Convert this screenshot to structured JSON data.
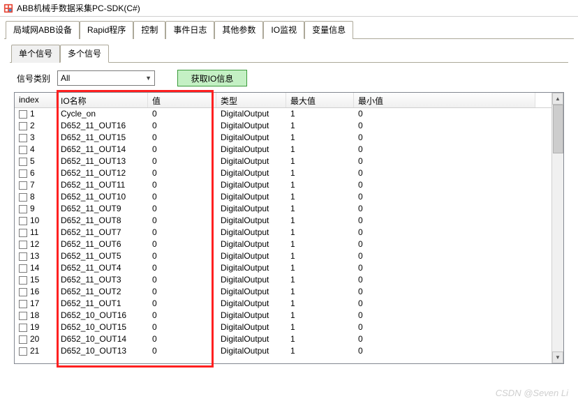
{
  "window": {
    "title": "ABB机械手数据采集PC-SDK(C#)"
  },
  "main_tabs": {
    "items": [
      {
        "label": "局域网ABB设备"
      },
      {
        "label": "Rapid程序"
      },
      {
        "label": "控制"
      },
      {
        "label": "事件日志"
      },
      {
        "label": "其他参数"
      },
      {
        "label": "IO监视"
      },
      {
        "label": "变量信息"
      }
    ],
    "active_index": 5
  },
  "sub_tabs": {
    "items": [
      {
        "label": "单个信号"
      },
      {
        "label": "多个信号"
      }
    ],
    "active_index": 1
  },
  "filter": {
    "label": "信号类别",
    "selected": "All",
    "button_label": "获取IO信息"
  },
  "columns": {
    "index": "index",
    "name": "IO名称",
    "value": "值",
    "type": "类型",
    "max": "最大值",
    "min": "最小值"
  },
  "rows": [
    {
      "index": "1",
      "name": "Cycle_on",
      "value": "0",
      "type": "DigitalOutput",
      "max": "1",
      "min": "0"
    },
    {
      "index": "2",
      "name": "D652_11_OUT16",
      "value": "0",
      "type": "DigitalOutput",
      "max": "1",
      "min": "0"
    },
    {
      "index": "3",
      "name": "D652_11_OUT15",
      "value": "0",
      "type": "DigitalOutput",
      "max": "1",
      "min": "0"
    },
    {
      "index": "4",
      "name": "D652_11_OUT14",
      "value": "0",
      "type": "DigitalOutput",
      "max": "1",
      "min": "0"
    },
    {
      "index": "5",
      "name": "D652_11_OUT13",
      "value": "0",
      "type": "DigitalOutput",
      "max": "1",
      "min": "0"
    },
    {
      "index": "6",
      "name": "D652_11_OUT12",
      "value": "0",
      "type": "DigitalOutput",
      "max": "1",
      "min": "0"
    },
    {
      "index": "7",
      "name": "D652_11_OUT11",
      "value": "0",
      "type": "DigitalOutput",
      "max": "1",
      "min": "0"
    },
    {
      "index": "8",
      "name": "D652_11_OUT10",
      "value": "0",
      "type": "DigitalOutput",
      "max": "1",
      "min": "0"
    },
    {
      "index": "9",
      "name": "D652_11_OUT9",
      "value": "0",
      "type": "DigitalOutput",
      "max": "1",
      "min": "0"
    },
    {
      "index": "10",
      "name": "D652_11_OUT8",
      "value": "0",
      "type": "DigitalOutput",
      "max": "1",
      "min": "0"
    },
    {
      "index": "11",
      "name": "D652_11_OUT7",
      "value": "0",
      "type": "DigitalOutput",
      "max": "1",
      "min": "0"
    },
    {
      "index": "12",
      "name": "D652_11_OUT6",
      "value": "0",
      "type": "DigitalOutput",
      "max": "1",
      "min": "0"
    },
    {
      "index": "13",
      "name": "D652_11_OUT5",
      "value": "0",
      "type": "DigitalOutput",
      "max": "1",
      "min": "0"
    },
    {
      "index": "14",
      "name": "D652_11_OUT4",
      "value": "0",
      "type": "DigitalOutput",
      "max": "1",
      "min": "0"
    },
    {
      "index": "15",
      "name": "D652_11_OUT3",
      "value": "0",
      "type": "DigitalOutput",
      "max": "1",
      "min": "0"
    },
    {
      "index": "16",
      "name": "D652_11_OUT2",
      "value": "0",
      "type": "DigitalOutput",
      "max": "1",
      "min": "0"
    },
    {
      "index": "17",
      "name": "D652_11_OUT1",
      "value": "0",
      "type": "DigitalOutput",
      "max": "1",
      "min": "0"
    },
    {
      "index": "18",
      "name": "D652_10_OUT16",
      "value": "0",
      "type": "DigitalOutput",
      "max": "1",
      "min": "0"
    },
    {
      "index": "19",
      "name": "D652_10_OUT15",
      "value": "0",
      "type": "DigitalOutput",
      "max": "1",
      "min": "0"
    },
    {
      "index": "20",
      "name": "D652_10_OUT14",
      "value": "0",
      "type": "DigitalOutput",
      "max": "1",
      "min": "0"
    },
    {
      "index": "21",
      "name": "D652_10_OUT13",
      "value": "0",
      "type": "DigitalOutput",
      "max": "1",
      "min": "0"
    }
  ],
  "watermark": "CSDN @Seven Li"
}
